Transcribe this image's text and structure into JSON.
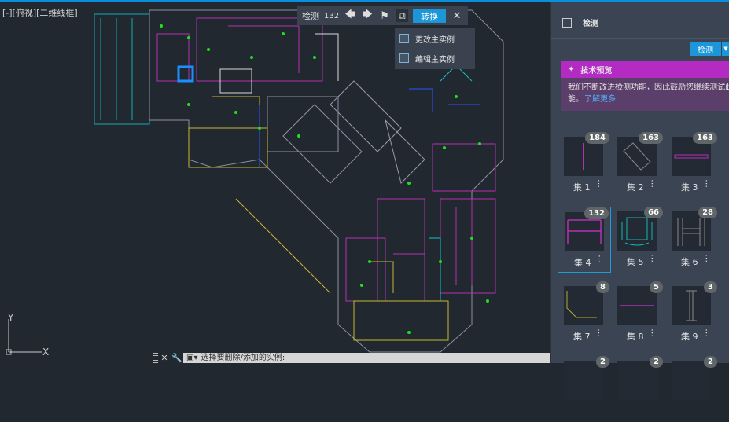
{
  "viewport": {
    "label": "[-][俯视][二维线框]"
  },
  "toolbar": {
    "title": "检测",
    "count": "132",
    "convert_label": "转换"
  },
  "menu": {
    "items": [
      {
        "label": "更改主实例"
      },
      {
        "label": "编辑主实例"
      }
    ]
  },
  "panel": {
    "title": "检测",
    "detect_label": "检测",
    "banner": {
      "title": "技术预览",
      "text": "我们不断改进检测功能，因此鼓励您继续测试此功能。",
      "link": "了解更多"
    },
    "sets": [
      {
        "label": "集 1",
        "count": "184"
      },
      {
        "label": "集 2",
        "count": "163"
      },
      {
        "label": "集 3",
        "count": "163"
      },
      {
        "label": "集 4",
        "count": "132"
      },
      {
        "label": "集 5",
        "count": "66"
      },
      {
        "label": "集 6",
        "count": "28"
      },
      {
        "label": "集 7",
        "count": "8"
      },
      {
        "label": "集 8",
        "count": "5"
      },
      {
        "label": "集 9",
        "count": "3"
      },
      {
        "label": "",
        "count": "2"
      },
      {
        "label": "",
        "count": "2"
      },
      {
        "label": "",
        "count": "2"
      }
    ]
  },
  "ucs": {
    "x": "X",
    "y": "Y"
  },
  "command": {
    "prompt": "选择要删除/添加的实例:"
  },
  "colors": {
    "accent": "#1b96d8",
    "banner": "#b42bc4",
    "canvas": "#212830",
    "panel": "#3b4453"
  }
}
